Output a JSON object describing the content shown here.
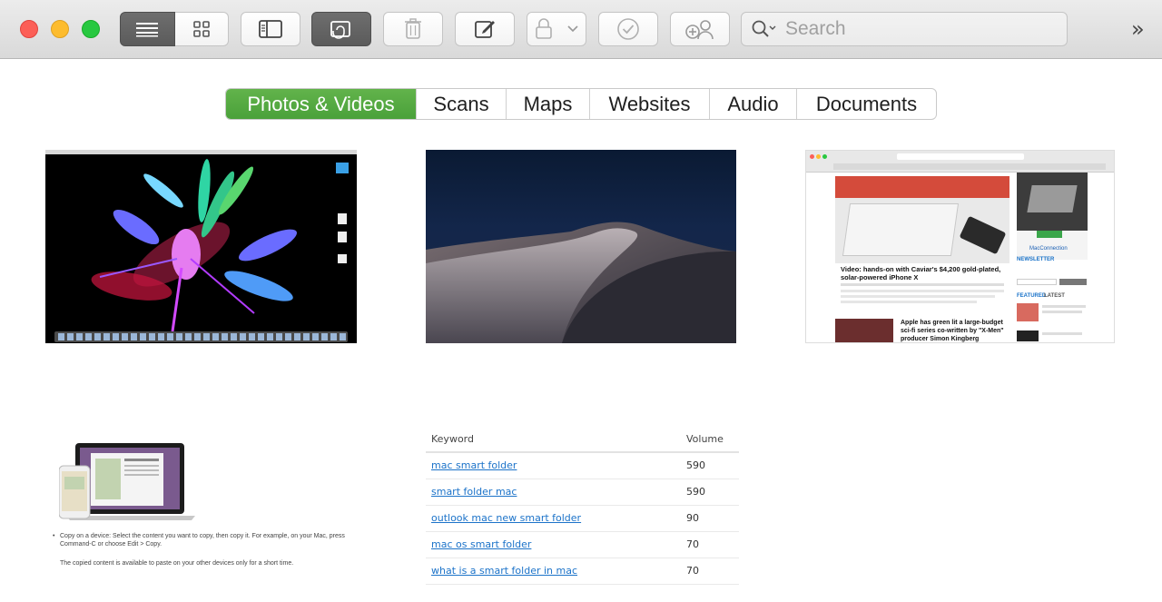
{
  "toolbar": {
    "search_placeholder": "Search",
    "overflow_label": "»",
    "buttons": [
      "list-view",
      "icon-view",
      "sidebar-toggle",
      "attachments",
      "delete",
      "new-note",
      "lock",
      "checklist",
      "share"
    ]
  },
  "tabs": [
    {
      "label": "Photos & Videos",
      "active": true
    },
    {
      "label": "Scans",
      "active": false
    },
    {
      "label": "Maps",
      "active": false
    },
    {
      "label": "Websites",
      "active": false
    },
    {
      "label": "Audio",
      "active": false
    },
    {
      "label": "Documents",
      "active": false
    }
  ],
  "colors": {
    "active_tab": "#4fa83e",
    "link": "#1c73c9",
    "traffic_red": "#fc5f57",
    "traffic_yellow": "#fdbc2e",
    "traffic_green": "#28c840"
  },
  "thumb3": {
    "article_title": "Video: hands-on with Caviar's $4,200 gold-plated, solar-powered iPhone X",
    "shop_label": "MacConnection",
    "newsletter_label": "NEWSLETTER",
    "featured_label": "FEATURED",
    "latest_label": "LATEST",
    "story2_title": "Apple has green lit a large-budget sci-fi series co-written by \"X-Men\" producer Simon Kingberg"
  },
  "thumb4": {
    "bullet_text": "Copy on a device: Select the content you want to copy, then copy it. For example, on your Mac, press Command-C or choose Edit > Copy.",
    "note_text": "The copied content is available to paste on your other devices only for a short time."
  },
  "keywords": {
    "headers": {
      "keyword": "Keyword",
      "volume": "Volume"
    },
    "rows": [
      {
        "keyword": "mac smart folder",
        "volume": "590"
      },
      {
        "keyword": "smart folder mac",
        "volume": "590"
      },
      {
        "keyword": "outlook mac new smart folder",
        "volume": "90"
      },
      {
        "keyword": "mac os smart folder",
        "volume": "70"
      },
      {
        "keyword": "what is a smart folder in mac",
        "volume": "70"
      }
    ]
  }
}
